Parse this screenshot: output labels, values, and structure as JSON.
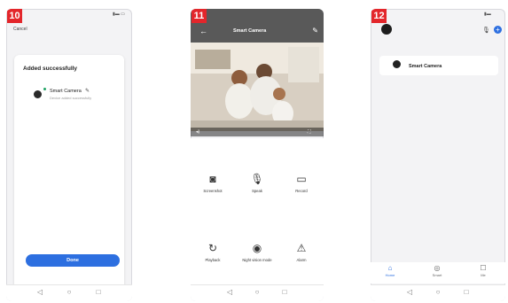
{
  "screens": [
    {
      "step": "10",
      "cancel": "Cancel",
      "title": "Added successfully",
      "device_name": "Smart Camera",
      "device_sub": "Device added successfully",
      "done": "Done"
    },
    {
      "step": "11",
      "title": "Smart Camera",
      "controls": [
        {
          "label": "Screenshot",
          "icon": "camera-icon"
        },
        {
          "label": "Speak",
          "icon": "microphone-icon"
        },
        {
          "label": "Record",
          "icon": "video-record-icon"
        },
        {
          "label": "Playback",
          "icon": "playback-icon"
        },
        {
          "label": "Night vision mode",
          "icon": "night-vision-icon"
        },
        {
          "label": "Alarm",
          "icon": "alarm-icon"
        }
      ]
    },
    {
      "step": "12",
      "device_name": "Smart Camera",
      "tabs": [
        {
          "label": "Home",
          "icon": "home-icon"
        },
        {
          "label": "Smart",
          "icon": "smart-icon"
        },
        {
          "label": "Me",
          "icon": "me-icon"
        }
      ]
    }
  ],
  "colors": {
    "accent": "#2d6fe0",
    "step_badge": "#e3262b",
    "online": "#21a366"
  }
}
